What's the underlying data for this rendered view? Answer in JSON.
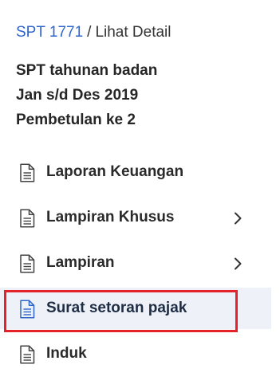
{
  "breadcrumb": {
    "link_label": "SPT 1771",
    "separator": "/",
    "current_label": "Lihat Detail"
  },
  "summary": {
    "line1": "SPT tahunan badan",
    "line2": "Jan s/d Des 2019",
    "line3": "Pembetulan ke 2"
  },
  "nav": {
    "items": [
      {
        "label": "Laporan Keuangan",
        "icon": "document-icon",
        "has_submenu": false
      },
      {
        "label": "Lampiran Khusus",
        "icon": "document-icon",
        "has_submenu": true
      },
      {
        "label": "Lampiran",
        "icon": "document-icon",
        "has_submenu": true
      },
      {
        "label": "Surat setoran pajak",
        "icon": "document-icon",
        "has_submenu": false,
        "active": true
      },
      {
        "label": "Induk",
        "icon": "document-icon",
        "has_submenu": false
      }
    ]
  },
  "colors": {
    "link": "#2f66c9",
    "active_background": "#eef2f8",
    "active_icon": "#2f66c9",
    "highlight_border": "#e3222a"
  }
}
